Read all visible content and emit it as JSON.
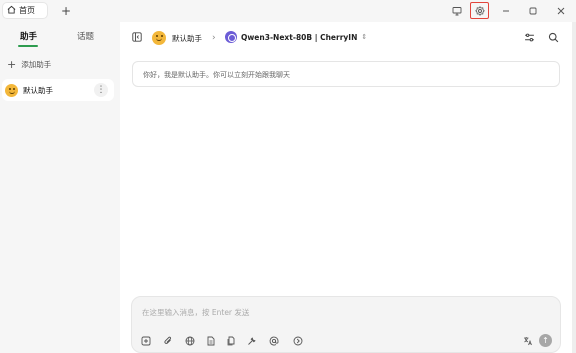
{
  "titlebar": {
    "home_tab_label": "首页",
    "add_tab_symbol": "+",
    "icons": [
      "monitor-icon",
      "settings-icon",
      "minimize-icon",
      "maximize-icon",
      "close-icon"
    ],
    "settings_highlight_color": "#e2453c"
  },
  "sidebar": {
    "tabs": [
      {
        "label": "助手",
        "active": true
      },
      {
        "label": "话题",
        "active": false
      }
    ],
    "accent_color": "#2e9c4f",
    "add_assistant_label": "添加助手",
    "assistants": [
      {
        "name": "默认助手",
        "icon": "smiley-emoji-icon"
      }
    ]
  },
  "header": {
    "assistant_name": "默认助手",
    "model_name": "Qwen3-Next-80B | CherryIN",
    "icons": [
      "collapse-sidebar-icon",
      "chevron-right-icon",
      "model-logo-icon",
      "updown-icon",
      "settings-sliders-icon",
      "search-icon"
    ]
  },
  "chat": {
    "greeting": "你好，我是默认助手。你可以立刻开始跟我聊天"
  },
  "composer": {
    "placeholder": "在这里输入消息，按 Enter 发送",
    "tools": [
      "new-topic-icon",
      "attachment-icon",
      "web-search-icon",
      "knowledge-icon",
      "file-icon",
      "tool-icon",
      "mention-icon",
      "expand-icon"
    ],
    "right_icons": [
      "translate-icon",
      "send-icon"
    ]
  }
}
